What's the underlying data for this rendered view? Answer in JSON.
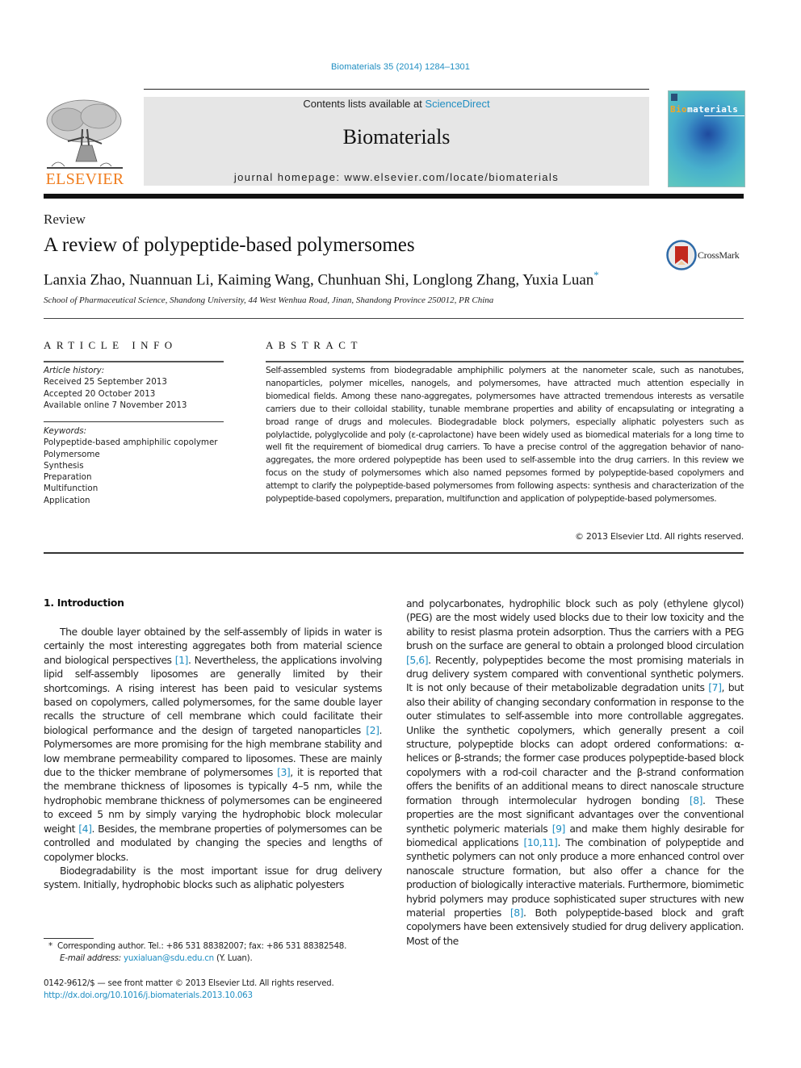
{
  "citation": "Biomaterials 35 (2014) 1284–1301",
  "header": {
    "contents_prefix": "Contents lists available at ",
    "contents_link": "ScienceDirect",
    "journal_name": "Biomaterials",
    "homepage": "journal homepage: www.elsevier.com/locate/biomaterials",
    "publisher_logo_text": "ELSEVIER",
    "cover": {
      "title_highlight": "Bio",
      "title_rest": "materials"
    }
  },
  "article": {
    "section_type": "Review",
    "title": "A review of polypeptide-based polymersomes",
    "authors": "Lanxia Zhao, Nuannuan Li, Kaiming Wang, Chunhuan Shi, Longlong Zhang, Yuxia Luan",
    "corresponding_mark": "*",
    "affiliation": "School of Pharmaceutical Science, Shandong University, 44 West Wenhua Road, Jinan, Shandong Province 250012, PR China",
    "crossmark_label": "CrossMark"
  },
  "article_info": {
    "heading": "ARTICLE INFO",
    "history_label": "Article history:",
    "history": [
      "Received 25 September 2013",
      "Accepted 20 October 2013",
      "Available online 7 November 2013"
    ],
    "keywords_label": "Keywords:",
    "keywords": [
      "Polypeptide-based amphiphilic copolymer",
      "Polymersome",
      "Synthesis",
      "Preparation",
      "Multifunction",
      "Application"
    ]
  },
  "abstract": {
    "heading": "ABSTRACT",
    "text": "Self-assembled systems from biodegradable amphiphilic polymers at the nanometer scale, such as nanotubes, nanoparticles, polymer micelles, nanogels, and polymersomes, have attracted much attention especially in biomedical fields. Among these nano-aggregates, polymersomes have attracted tremendous interests as versatile carriers due to their colloidal stability, tunable membrane properties and ability of encapsulating or integrating a broad range of drugs and molecules. Biodegradable block polymers, especially aliphatic polyesters such as polylactide, polyglycolide and poly (ε-caprolactone) have been widely used as biomedical materials for a long time to well fit the requirement of biomedical drug carriers. To have a precise control of the aggregation behavior of nano-aggregates, the more ordered polypeptide has been used to self-assemble into the drug carriers. In this review we focus on the study of polymersomes which also named pepsomes formed by polypeptide-based copolymers and attempt to clarify the polypeptide-based polymersomes from following aspects: synthesis and characterization of the polypeptide-based copolymers, preparation, multifunction and application of polypeptide-based polymersomes.",
    "copyright": "© 2013 Elsevier Ltd. All rights reserved."
  },
  "body": {
    "intro_heading": "1.  Introduction",
    "left": {
      "p1": [
        "The double layer obtained by the self-assembly of lipids in water is certainly the most interesting aggregates both from material science and biological perspectives ",
        "[1]",
        ". Nevertheless, the applications involving lipid self-assembly liposomes are generally limited by their shortcomings. A rising interest has been paid to vesicular systems based on copolymers, called polymersomes, for the same double layer recalls the structure of cell membrane which could facilitate their biological performance and the design of targeted nanoparticles ",
        "[2]",
        ". Polymersomes are more promising for the high membrane stability and low membrane permeability compared to liposomes. These are mainly due to the thicker membrane of polymersomes ",
        "[3]",
        ", it is reported that the membrane thickness of liposomes is typically 4–5 nm, while the hydrophobic membrane thickness of polymersomes can be engineered to exceed 5 nm by simply varying the hydrophobic block molecular weight ",
        "[4]",
        ". Besides, the membrane properties of polymersomes can be controlled and modulated by changing the species and lengths of copolymer blocks."
      ],
      "p2": "Biodegradability is the most important issue for drug delivery system. Initially, hydrophobic blocks such as aliphatic polyesters"
    },
    "right": {
      "p1": [
        "and polycarbonates, hydrophilic block such as poly (ethylene glycol) (PEG) are the most widely used blocks due to their low toxicity and the ability to resist plasma protein adsorption. Thus the carriers with a PEG brush on the surface are general to obtain a prolonged blood circulation ",
        "[5,6]",
        ". Recently, polypeptides become the most promising materials in drug delivery system compared with conventional synthetic polymers. It is not only because of their metabolizable degradation units ",
        "[7]",
        ", but also their ability of changing secondary conformation in response to the outer stimulates to self-assemble into more controllable aggregates. Unlike the synthetic copolymers, which generally present a coil structure, polypeptide blocks can adopt ordered conformations: α-helices or β-strands; the former case produces polypeptide-based block copolymers with a rod-coil character and the β-strand conformation offers the benifits of an additional means to direct nanoscale structure formation through intermolecular hydrogen bonding ",
        "[8]",
        ". These properties are the most significant advantages over the conventional synthetic polymeric materials ",
        "[9]",
        " and make them highly desirable for biomedical applications ",
        "[10,11]",
        ". The combination of polypeptide and synthetic polymers can not only produce a more enhanced control over nanoscale structure formation, but also offer a chance for the production of biologically interactive materials. Furthermore, biomimetic hybrid polymers may produce sophisticated super structures with new material properties ",
        "[8]",
        ". Both polypeptide-based block and graft copolymers have been extensively studied for drug delivery application. Most of the"
      ]
    }
  },
  "footnote": {
    "mark": "*",
    "corresponding": "Corresponding author. Tel.: +86 531 88382007; fax: +86 531 88382548.",
    "email_label": "E-mail address:",
    "email": "yuxialuan@sdu.edu.cn",
    "email_suffix": " (Y. Luan)."
  },
  "front_matter": {
    "issn_line": "0142-9612/$ — see front matter © 2013 Elsevier Ltd. All rights reserved.",
    "doi": "http://dx.doi.org/10.1016/j.biomaterials.2013.10.063"
  }
}
